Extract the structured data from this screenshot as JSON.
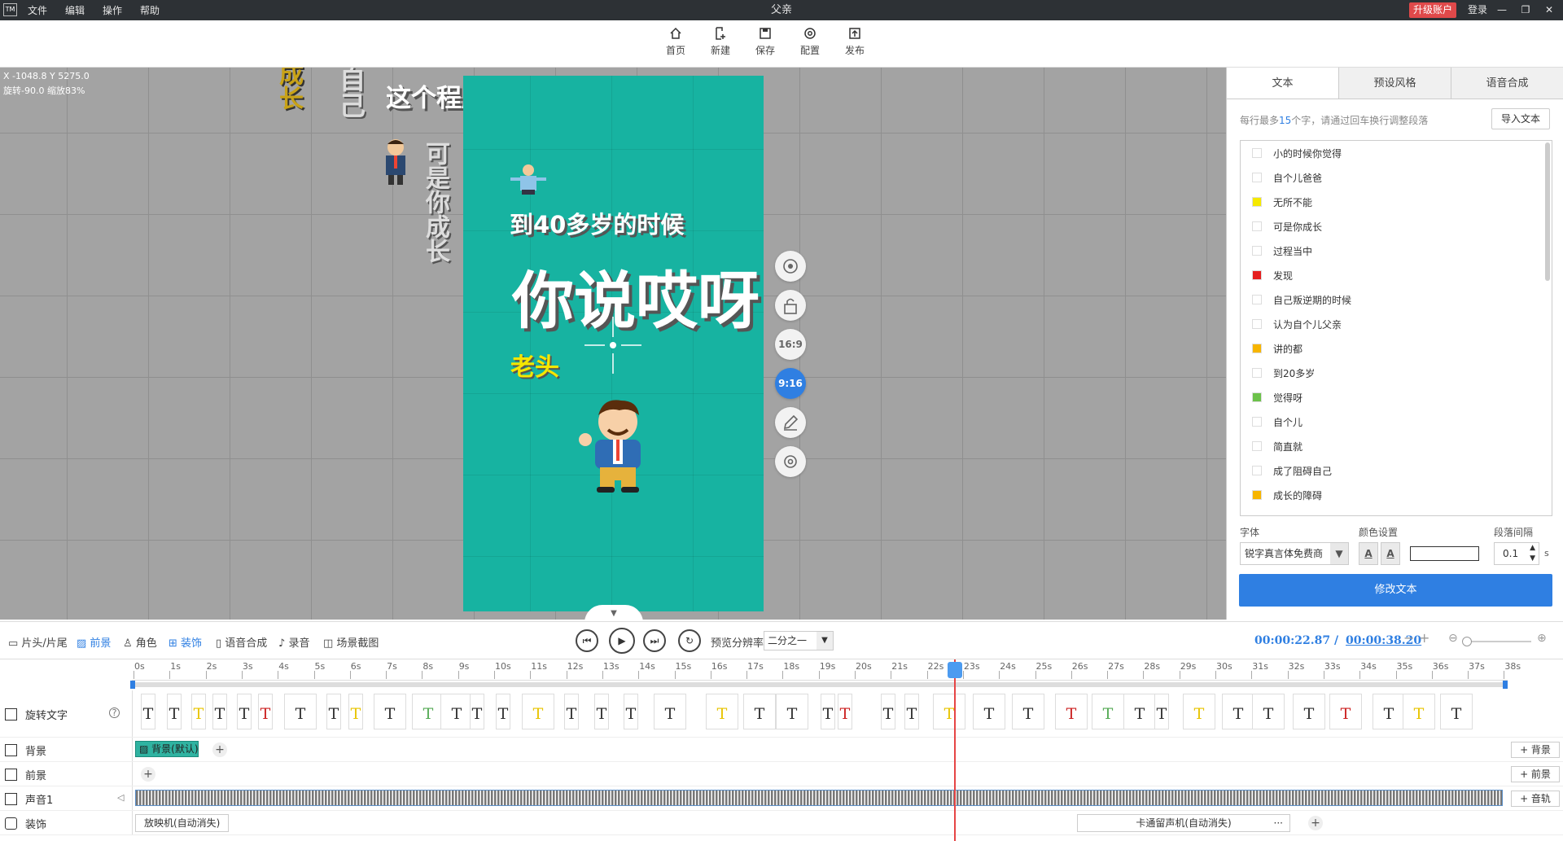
{
  "app": {
    "logo": "TM",
    "title": "父亲",
    "menu": [
      "文件",
      "编辑",
      "操作",
      "帮助"
    ],
    "upgrade": "升级账户",
    "login": "登录"
  },
  "toolbar": [
    {
      "label": "首页",
      "icon": "home-icon"
    },
    {
      "label": "新建",
      "icon": "new-file-icon"
    },
    {
      "label": "保存",
      "icon": "save-icon"
    },
    {
      "label": "配置",
      "icon": "settings-icon"
    },
    {
      "label": "发布",
      "icon": "publish-icon"
    }
  ],
  "canvas": {
    "coords": "X -1048.8 Y 5275.0",
    "rotation": "旋转-90.0 缩放83%",
    "text_main": "你说哎呀",
    "text_sub": "到40多岁的时候",
    "text_yellow": "老头",
    "text_top": "这个程度",
    "v_text1": "成长",
    "v_text2": "可是你成长",
    "v_text3": "自己",
    "side_buttons": [
      "16:9",
      "9:16"
    ]
  },
  "panel": {
    "tabs": [
      "文本",
      "预设风格",
      "语音合成"
    ],
    "hint_pre": "每行最多",
    "hint_num": "15",
    "hint_post": "个字，请通过回车换行调整段落",
    "import": "导入文本",
    "lines": [
      {
        "text": "小的时候你觉得",
        "color": "#ffffff"
      },
      {
        "text": "自个儿爸爸",
        "color": "#ffffff"
      },
      {
        "text": "无所不能",
        "color": "#f5e900"
      },
      {
        "text": "可是你成长",
        "color": "#ffffff"
      },
      {
        "text": "过程当中",
        "color": "#ffffff"
      },
      {
        "text": "发现",
        "color": "#e51e1e"
      },
      {
        "text": "自己叛逆期的时候",
        "color": "#ffffff"
      },
      {
        "text": "认为自个儿父亲",
        "color": "#ffffff"
      },
      {
        "text": "讲的都",
        "color": "#f7b500"
      },
      {
        "text": "到20多岁",
        "color": "#ffffff"
      },
      {
        "text": "觉得呀",
        "color": "#6cc24a"
      },
      {
        "text": "自个儿",
        "color": "#ffffff"
      },
      {
        "text": "简直就",
        "color": "#ffffff"
      },
      {
        "text": "成了阻碍自己",
        "color": "#ffffff"
      },
      {
        "text": "成长的障碍",
        "color": "#f7b500"
      }
    ],
    "font_label": "字体",
    "color_label": "颜色设置",
    "spacing_label": "段落间隔",
    "font_value": "锐字真言体免费商",
    "spacing_value": "0.1",
    "spacing_unit": "s",
    "modify": "修改文本"
  },
  "bottom": {
    "tabs": [
      "片头/片尾",
      "前景",
      "角色",
      "装饰",
      "语音合成",
      "录音",
      "场景截图"
    ],
    "preview_label": "预览分辨率",
    "preview_value": "二分之一",
    "current_time": "00:00:22.87",
    "total_time": "00:00:38.20"
  },
  "timeline": {
    "ruler": [
      "0s",
      "1s",
      "2s",
      "3s",
      "4s",
      "5s",
      "6s",
      "7s",
      "8s",
      "9s",
      "10s",
      "11s",
      "12s",
      "13s",
      "14s",
      "15s",
      "16s",
      "17s",
      "18s",
      "19s",
      "20s",
      "21s",
      "22s",
      "23s",
      "24s",
      "25s",
      "26s",
      "27s",
      "28s",
      "29s",
      "30s",
      "31s",
      "32s",
      "33s",
      "34s",
      "35s",
      "36s",
      "37s",
      "38s"
    ],
    "tracks": {
      "rotate_text": "旋转文字",
      "background": "背景",
      "foreground": "前景",
      "audio": "声音1",
      "decoration": "装饰"
    },
    "bg_clip": "背景(默认)",
    "add_bg": "+ 背景",
    "add_fg": "+ 前景",
    "add_audio": "+ 音轨",
    "deco_clip1": "放映机(自动消失)",
    "deco_clip2": "卡通留声机(自动消失)",
    "clip_glyph": "T"
  },
  "colors": {
    "accent": "#2f7fe2",
    "canvas_bg": "#17b3a1"
  }
}
